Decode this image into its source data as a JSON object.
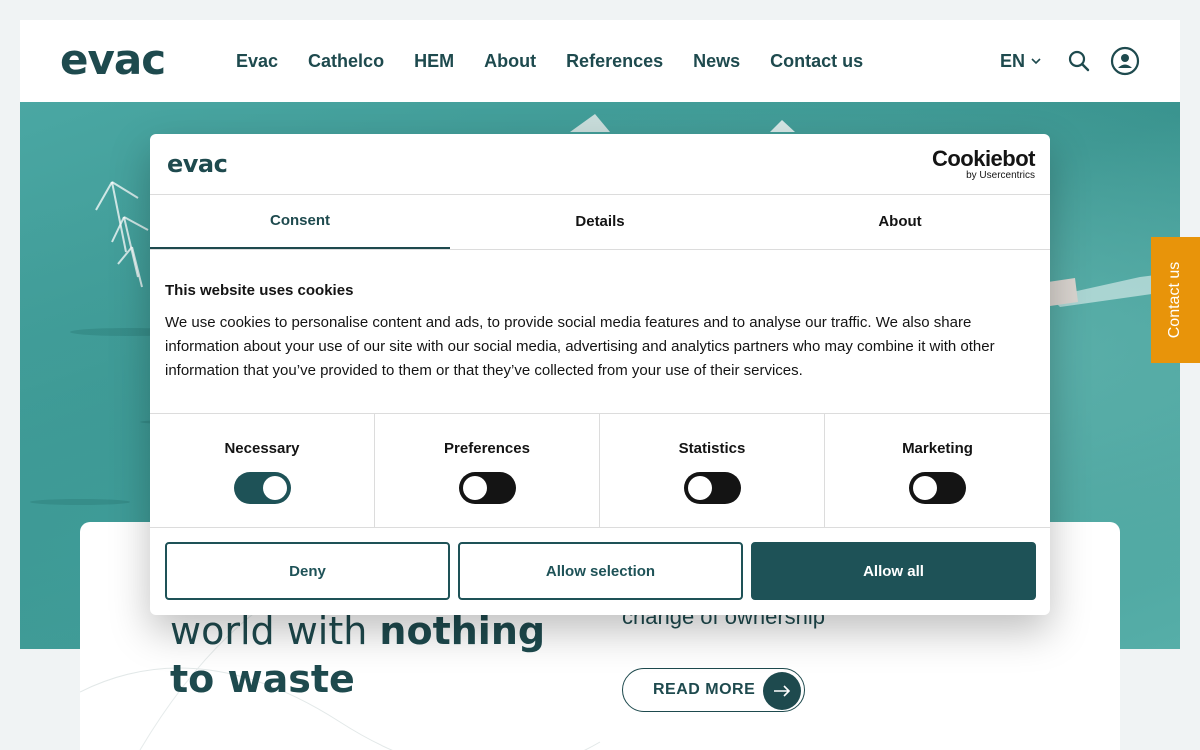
{
  "header": {
    "logo": "evac",
    "nav": [
      "Evac",
      "Cathelco",
      "HEM",
      "About",
      "References",
      "News",
      "Contact us"
    ],
    "lang": "EN"
  },
  "side_tab": {
    "label": "Contact us"
  },
  "card": {
    "title_regular": "world with ",
    "title_bold_1": "nothing",
    "title_bold_2": "to waste",
    "subtitle": "change of ownership",
    "read_more": "READ MORE"
  },
  "dialog": {
    "logo": "evac",
    "cookiebot": "Cookiebot",
    "cookiebot_sub": "by Usercentrics",
    "tabs": [
      {
        "label": "Consent"
      },
      {
        "label": "Details"
      },
      {
        "label": "About"
      }
    ],
    "heading": "This website uses cookies",
    "text": "We use cookies to personalise content and ads, to provide social media features and to analyse our traffic. We also share information about your use of our site with our social media, advertising and analytics partners who may combine it with other information that you’ve provided to them or that they’ve collected from your use of their services.",
    "toggles": [
      {
        "label": "Necessary"
      },
      {
        "label": "Preferences"
      },
      {
        "label": "Statistics"
      },
      {
        "label": "Marketing"
      }
    ],
    "buttons": {
      "deny": "Deny",
      "allow_selection": "Allow selection",
      "allow_all": "Allow all"
    }
  },
  "colors": {
    "brand": "#1e4a4e",
    "accent": "#e8940a",
    "button": "#1e5257"
  }
}
